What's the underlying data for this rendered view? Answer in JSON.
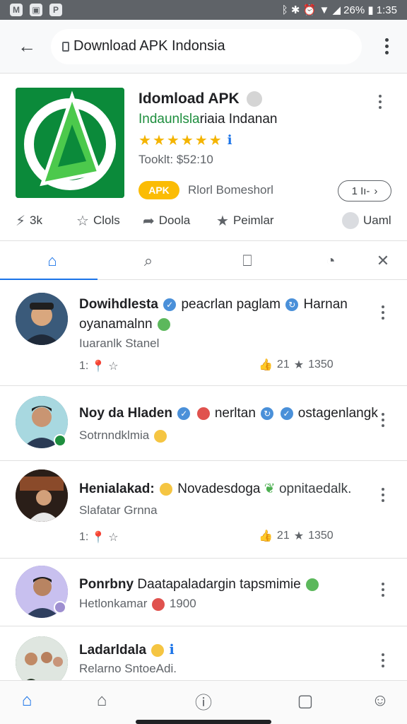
{
  "status_bar": {
    "left_icons": [
      "M",
      "▣",
      "P"
    ],
    "right_text": "ᛒ ✱ ⏰ ▼ ◢ 26% ▮ 1:35",
    "time": "1:35",
    "battery": "26%"
  },
  "browser": {
    "back_glyph": "←",
    "url": "Download APK Indonsia"
  },
  "app": {
    "title": "Idomload APK",
    "developer_green": "Indaunlsla",
    "developer_rest": "riaia Indanan",
    "rating_stars": 5,
    "rating_value": 0.95,
    "size_text": "Tooklt: $52:10",
    "apk_label": "APK",
    "apk_subtitle": "Rlorl Bomeshorl",
    "install_label": "1 Iı-",
    "install_arrow": "›",
    "icon_color": "#0b8a3a",
    "icon_accent": "#4cc94c"
  },
  "actions": [
    {
      "icon": "flash-icon",
      "glyph": "⚡",
      "label": "3k"
    },
    {
      "icon": "star-outline-icon",
      "glyph": "☆",
      "label": "Clols"
    },
    {
      "icon": "share-icon",
      "glyph": "➦",
      "label": "Doola"
    },
    {
      "icon": "star-filled-icon",
      "glyph": "★",
      "label": "Peimlar"
    },
    {
      "icon": "user-icon",
      "glyph": "",
      "label": "Uaml"
    }
  ],
  "tabs": [
    {
      "name": "home",
      "glyph": "⌂",
      "active": true
    },
    {
      "name": "search",
      "glyph": "⌕",
      "active": false
    },
    {
      "name": "bookmark",
      "glyph": "⎕",
      "active": false
    },
    {
      "name": "clock",
      "glyph": "◔",
      "active": false
    },
    {
      "name": "close",
      "glyph": "✕",
      "active": false
    }
  ],
  "posts": [
    {
      "name": "Dowihdlesta",
      "text": "peacrlan paglam",
      "text2": "Harnan",
      "line2": "oyanamalnn",
      "sub": "Iuaranlk Stanel",
      "stats_left": "1:",
      "likes": "21",
      "stars": "1350",
      "avatar_color": "#2b3a55"
    },
    {
      "name": "Noy da Hladen",
      "text": "nerltan",
      "text2": "ostagenlangk",
      "sub": "Sotrnndklmia",
      "avatar_color": "#4d7a8f"
    },
    {
      "name": "Henialakad:",
      "text": "Novadesdoga",
      "text2": "opnitaedalk.",
      "sub": "Slafatar Grnna",
      "stats_left": "1:",
      "likes": "21",
      "stars": "1350",
      "avatar_color": "#5a3e2b"
    },
    {
      "name": "Ponrbny",
      "text": "Daatapaladargin",
      "text2": "tapsmimie",
      "sub": "Hetlonkamar",
      "sub2": "1900",
      "avatar_color": "#6b5fa8"
    },
    {
      "name": "Ladarldala",
      "sub": "Relarno SntoeAdi.",
      "avatar_color": "#3d6b4a"
    }
  ],
  "bottom_nav": [
    {
      "name": "home",
      "glyph": "⌂"
    },
    {
      "name": "house-outline",
      "glyph": "⌂"
    },
    {
      "name": "info",
      "glyph": "ⓘ"
    },
    {
      "name": "chat",
      "glyph": "▢"
    },
    {
      "name": "profile",
      "glyph": "☺"
    }
  ],
  "colors": {
    "accent": "#1a73e8",
    "apk_pill": "#fbbc04",
    "star": "#f4b400",
    "developer": "#1e8e3e"
  }
}
